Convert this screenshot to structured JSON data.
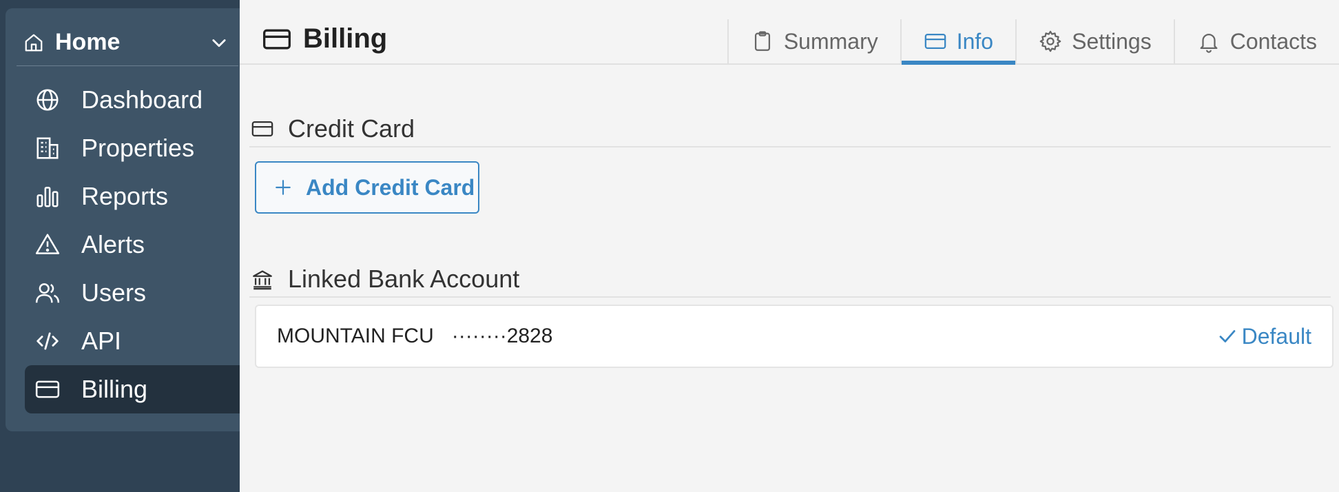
{
  "sidebar": {
    "home_label": "Home",
    "items": [
      {
        "label": "Dashboard"
      },
      {
        "label": "Properties"
      },
      {
        "label": "Reports"
      },
      {
        "label": "Alerts"
      },
      {
        "label": "Users"
      },
      {
        "label": "API"
      },
      {
        "label": "Billing",
        "active": true
      }
    ]
  },
  "header": {
    "title": "Billing",
    "tabs": [
      {
        "label": "Summary",
        "icon": "clipboard-icon"
      },
      {
        "label": "Info",
        "icon": "credit-card-icon",
        "active": true
      },
      {
        "label": "Settings",
        "icon": "gear-icon"
      },
      {
        "label": "Contacts",
        "icon": "bell-icon"
      }
    ]
  },
  "credit_card": {
    "section_title": "Credit Card",
    "add_button_label": "Add Credit Card"
  },
  "bank": {
    "section_title": "Linked Bank Account",
    "account_name": "MOUNTAIN FCU",
    "account_mask": "········2828",
    "status": "Default"
  },
  "colors": {
    "accent": "#3a87c4",
    "sidebar_bg": "#2f4254",
    "sidebar_panel": "#3e5467",
    "sidebar_active": "#23313e"
  }
}
